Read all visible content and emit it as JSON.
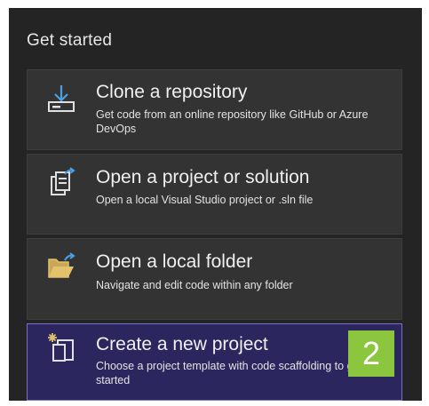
{
  "header": {
    "title": "Get started"
  },
  "actions": [
    {
      "title": "Clone a repository",
      "description": "Get code from an online repository like GitHub or Azure DevOps",
      "icon": "download-icon"
    },
    {
      "title": "Open a project or solution",
      "description": "Open a local Visual Studio project or .sln file",
      "icon": "open-project-icon"
    },
    {
      "title": "Open a local folder",
      "description": "Navigate and edit code within any folder",
      "icon": "open-folder-icon"
    },
    {
      "title": "Create a new project",
      "description": "Choose a project template with code scaffolding to get started",
      "icon": "new-project-icon"
    }
  ],
  "badge": {
    "label": "2"
  },
  "colors": {
    "accent_blue": "#4aa0e6",
    "folder_yellow": "#e3c26c",
    "badge_green": "#8cc63f",
    "selected_bg": "#2c265e"
  }
}
